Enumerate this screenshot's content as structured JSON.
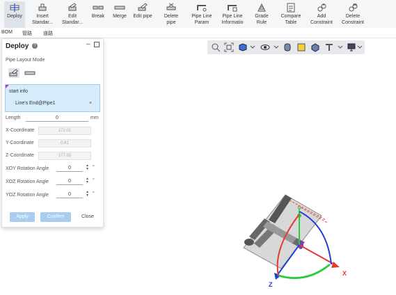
{
  "toolbar": {
    "items": [
      {
        "label": "Deploy"
      },
      {
        "label": "Insert Standar..."
      },
      {
        "label": "Edit Standar..."
      },
      {
        "label": "Break"
      },
      {
        "label": "Merge"
      },
      {
        "label": "Edit pipe"
      },
      {
        "label": "Delete pipe"
      },
      {
        "label": "Pipe Line Param"
      },
      {
        "label": "Pipe Line Informatio"
      },
      {
        "label": "Grade Rule"
      },
      {
        "label": "Compare Table"
      },
      {
        "label": "Add Constraint"
      },
      {
        "label": "Delete Constraint"
      }
    ]
  },
  "subbar": {
    "items": [
      "BOM",
      "管路",
      "道路"
    ]
  },
  "panel": {
    "title": "Deploy",
    "mode_label": "Pipe Layout Mode",
    "start_info_label": "start info",
    "start_value": "Line's End@Pipe1",
    "length_label": "Length",
    "length_value": "0",
    "length_unit": "mm",
    "x_label": "X-Coordinate",
    "x_value": "172.01",
    "y_label": "Y-Coordinate",
    "y_value": "0.61",
    "z_label": "Z-Coordinate",
    "z_value": "177.05",
    "xoy_label": "XOY Rotation Angle",
    "xoy_value": "0",
    "xoz_label": "XOZ Rotation Angle",
    "xoz_value": "0",
    "yoz_label": "YOZ Rotation Angle",
    "yoz_value": "0",
    "degree": "°",
    "apply": "Apply",
    "confirm": "Confirm",
    "close": "Close",
    "clear": "×"
  },
  "axes": {
    "x": "X",
    "y": "Y",
    "z": "Z"
  },
  "colors": {
    "x_axis": "#e53935",
    "y_axis": "#2ecc40",
    "z_axis": "#1e3fd8",
    "accent": "#9ccbee"
  }
}
